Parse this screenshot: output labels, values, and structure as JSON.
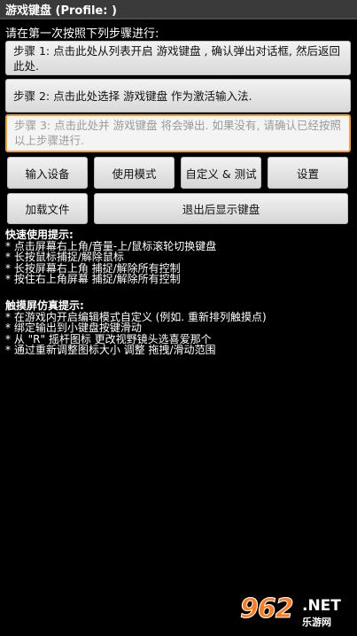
{
  "titlebar": {
    "title": "游戏键盘 (Profile: )"
  },
  "instruction": "请在第一次按照下列步骤进行:",
  "steps": [
    {
      "label": "步骤 1: 点击此处从列表开启 游戏键盘 , 确认弹出对话框, 然后返回此处."
    },
    {
      "label": "步骤 2: 点击此处选择 游戏键盘 作为激活输入法."
    },
    {
      "label": "步骤 3: 点击此处并 游戏键盘 将会弹出. 如果没有, 请确认已经按照以上步骤进行."
    }
  ],
  "buttons": {
    "input_device": "输入设备",
    "use_mode": "使用模式",
    "custom_test": "自定义 & 测试",
    "settings": "设置",
    "load_file": "加载文件",
    "exit_show_keyboard": "退出后显示键盘"
  },
  "quick_tips": {
    "heading": "快速使用提示:",
    "lines": [
      "* 点击屏幕右上角/音量-上/鼠标滚轮切换键盘",
      "* 长按鼠标捕捉/解除鼠标",
      "* 长按屏幕右上角 捕捉/解除所有控制",
      "* 按住右上角屏幕 捕捉/解除所有控制"
    ]
  },
  "touch_tips": {
    "heading": "触摸屏仿真提示:",
    "lines": [
      "* 在游戏内开启编辑模式自定义 (例如. 重新排列触摸点)",
      "* 绑定输出到小键盘按键滑动",
      "* 从 \"R\" 摇杆图标 更改视野镜头选喜爱那个",
      "* 通过重新调整图标大小 调整 拖拽/滑动范围"
    ]
  },
  "watermark": {
    "number": "962",
    "net": ".NET",
    "cn": "乐游网"
  }
}
